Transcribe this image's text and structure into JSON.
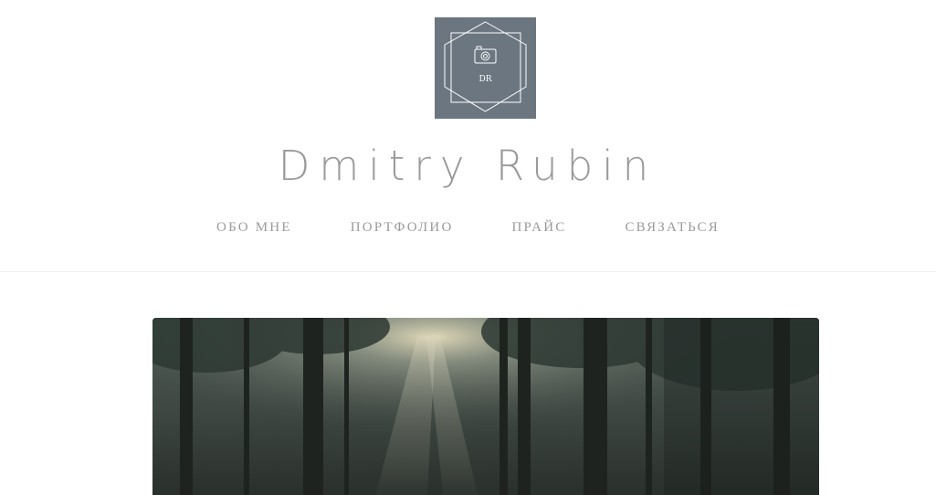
{
  "header": {
    "logo": {
      "initials": "DR",
      "icon": "camera-icon",
      "background": "#6b7680"
    },
    "title": "Dmitry Rubin"
  },
  "nav": {
    "items": [
      {
        "label": "ОБО МНЕ"
      },
      {
        "label": "ПОРТФОЛИО"
      },
      {
        "label": "ПРАЙС"
      },
      {
        "label": "СВЯЗАТЬСЯ"
      }
    ]
  },
  "hero": {
    "image": "forest-photo",
    "palette": {
      "dark": "#2a302c",
      "mid": "#4e5a55",
      "light": "#c9c2a8"
    }
  }
}
